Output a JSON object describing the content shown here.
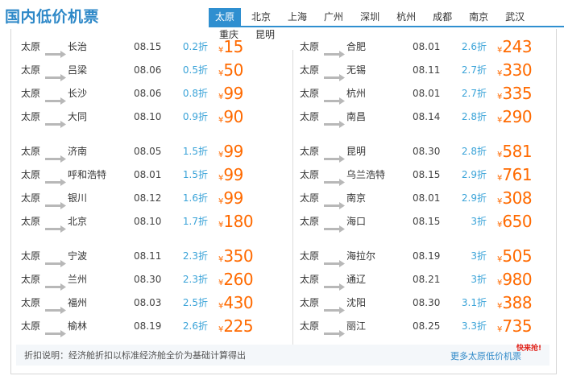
{
  "title": "国内低价机票",
  "tabs": [
    "太原",
    "北京",
    "上海",
    "广州",
    "深圳",
    "杭州",
    "成都",
    "南京",
    "武汉",
    "重庆",
    "昆明"
  ],
  "active_tab": "太原",
  "left_groups": [
    [
      {
        "from": "太原",
        "to": "长治",
        "date": "08.15",
        "discount": "0.2折",
        "yen": "¥",
        "price": "15"
      },
      {
        "from": "太原",
        "to": "吕梁",
        "date": "08.06",
        "discount": "0.5折",
        "yen": "¥",
        "price": "50"
      },
      {
        "from": "太原",
        "to": "长沙",
        "date": "08.06",
        "discount": "0.8折",
        "yen": "¥",
        "price": "99"
      },
      {
        "from": "太原",
        "to": "大同",
        "date": "08.10",
        "discount": "0.9折",
        "yen": "¥",
        "price": "90"
      }
    ],
    [
      {
        "from": "太原",
        "to": "济南",
        "date": "08.05",
        "discount": "1.5折",
        "yen": "¥",
        "price": "99"
      },
      {
        "from": "太原",
        "to": "呼和浩特",
        "date": "08.01",
        "discount": "1.5折",
        "yen": "¥",
        "price": "99"
      },
      {
        "from": "太原",
        "to": "银川",
        "date": "08.12",
        "discount": "1.6折",
        "yen": "¥",
        "price": "99"
      },
      {
        "from": "太原",
        "to": "北京",
        "date": "08.10",
        "discount": "1.7折",
        "yen": "¥",
        "price": "180"
      }
    ],
    [
      {
        "from": "太原",
        "to": "宁波",
        "date": "08.11",
        "discount": "2.3折",
        "yen": "¥",
        "price": "350"
      },
      {
        "from": "太原",
        "to": "兰州",
        "date": "08.30",
        "discount": "2.3折",
        "yen": "¥",
        "price": "260"
      },
      {
        "from": "太原",
        "to": "福州",
        "date": "08.03",
        "discount": "2.5折",
        "yen": "¥",
        "price": "430"
      },
      {
        "from": "太原",
        "to": "榆林",
        "date": "08.19",
        "discount": "2.6折",
        "yen": "¥",
        "price": "225"
      }
    ]
  ],
  "right_groups": [
    [
      {
        "from": "太原",
        "to": "合肥",
        "date": "08.01",
        "discount": "2.6折",
        "yen": "¥",
        "price": "243"
      },
      {
        "from": "太原",
        "to": "无锡",
        "date": "08.11",
        "discount": "2.7折",
        "yen": "¥",
        "price": "330"
      },
      {
        "from": "太原",
        "to": "杭州",
        "date": "08.01",
        "discount": "2.7折",
        "yen": "¥",
        "price": "335"
      },
      {
        "from": "太原",
        "to": "南昌",
        "date": "08.14",
        "discount": "2.8折",
        "yen": "¥",
        "price": "290"
      }
    ],
    [
      {
        "from": "太原",
        "to": "昆明",
        "date": "08.30",
        "discount": "2.8折",
        "yen": "¥",
        "price": "581"
      },
      {
        "from": "太原",
        "to": "乌兰浩特",
        "date": "08.15",
        "discount": "2.9折",
        "yen": "¥",
        "price": "761"
      },
      {
        "from": "太原",
        "to": "南京",
        "date": "08.01",
        "discount": "2.9折",
        "yen": "¥",
        "price": "308"
      },
      {
        "from": "太原",
        "to": "海口",
        "date": "08.15",
        "discount": "3折",
        "yen": "¥",
        "price": "650"
      }
    ],
    [
      {
        "from": "太原",
        "to": "海拉尔",
        "date": "08.19",
        "discount": "3折",
        "yen": "¥",
        "price": "505"
      },
      {
        "from": "太原",
        "to": "通辽",
        "date": "08.21",
        "discount": "3折",
        "yen": "¥",
        "price": "980"
      },
      {
        "from": "太原",
        "to": "沈阳",
        "date": "08.30",
        "discount": "3.1折",
        "yen": "¥",
        "price": "388"
      },
      {
        "from": "太原",
        "to": "丽江",
        "date": "08.25",
        "discount": "3.3折",
        "yen": "¥",
        "price": "735"
      }
    ]
  ],
  "footer": {
    "note": "折扣说明：经济舱折扣以标准经济舱全价为基础计算得出",
    "more_link": "更多太原低价机票",
    "badge": "快来抢!"
  },
  "colors": {
    "accent": "#2f8fd0",
    "price": "#ff6a00",
    "discount": "#3aa3d8",
    "badge": "#e2231a"
  },
  "icons": {
    "route_arrow": "arrow-right-icon"
  }
}
